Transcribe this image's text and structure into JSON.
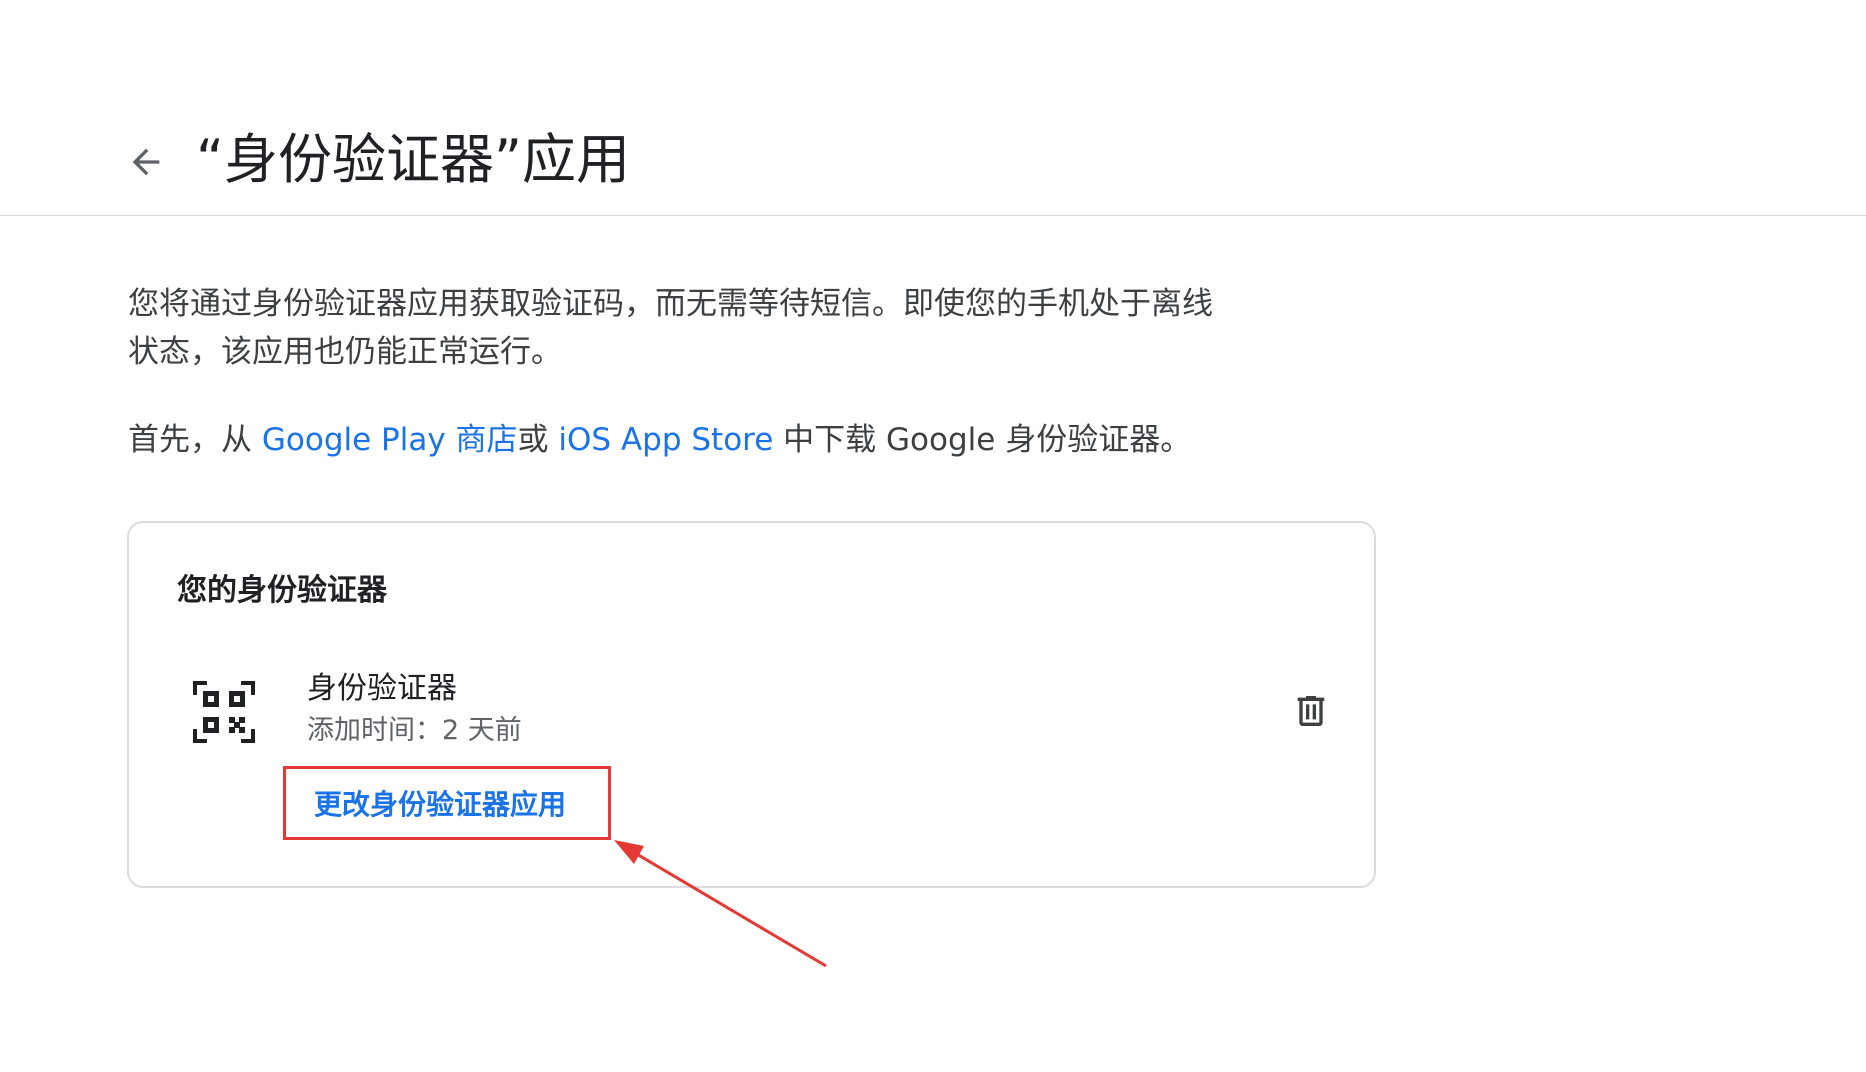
{
  "header": {
    "title": "“身份验证器”应用",
    "back_icon": "arrow-left-icon"
  },
  "intro": {
    "description": "您将通过身份验证器应用获取验证码，而无需等待短信。即使您的手机处于离线状态，该应用也仍能正常运行。",
    "download_prefix": "首先，从 ",
    "google_play_link": "Google Play 商店",
    "or_text": "或 ",
    "app_store_link": "iOS App Store",
    "download_suffix": " 中下载 Google 身份验证器。"
  },
  "card": {
    "title": "您的身份验证器",
    "authenticator": {
      "icon": "qr-code-icon",
      "name": "身份验证器",
      "added": "添加时间：2 天前",
      "delete_icon": "trash-icon"
    },
    "change_label": "更改身份验证器应用"
  },
  "colors": {
    "link": "#1a73e8",
    "highlight_box": "#e53935",
    "divider": "#dadce0",
    "text_primary": "#202124",
    "text_secondary": "#5f6368"
  }
}
